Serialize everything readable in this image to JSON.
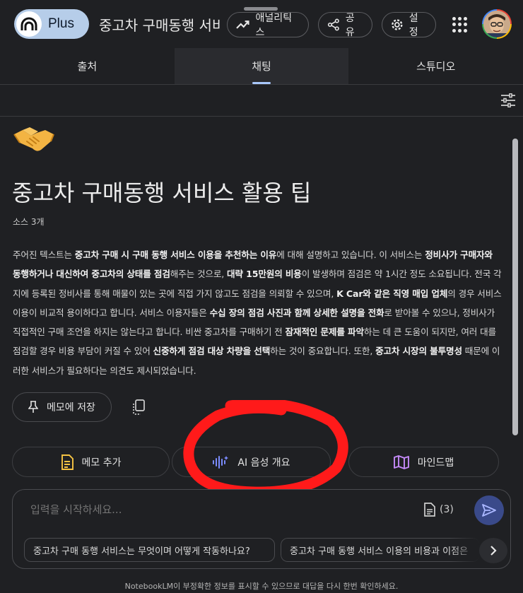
{
  "header": {
    "logo_label": "Plus",
    "notebook_title": "중고차 구매동행 서비",
    "analytics_label": "애널리틱스",
    "share_label": "공유",
    "settings_label": "설정"
  },
  "tabs": [
    {
      "label": "출처",
      "active": false
    },
    {
      "label": "채팅",
      "active": true
    },
    {
      "label": "스튜디오",
      "active": false
    }
  ],
  "note": {
    "emoji": "handshake-emoji",
    "title": "중고차 구매동행 서비스 활용 팁",
    "source_count": "소스 3개",
    "summary_segments": [
      {
        "t": "주어진 텍스트는 ",
        "b": false
      },
      {
        "t": "중고차 구매 시 구매 동행 서비스 이용을 추천하는 이유",
        "b": true
      },
      {
        "t": "에 대해 설명하고 있습니다. 이 서비스는 ",
        "b": false
      },
      {
        "t": "정비사가 구매자와 동행하거나 대신하여 중고차의 상태를 점검",
        "b": true
      },
      {
        "t": "해주는 것으로, ",
        "b": false
      },
      {
        "t": "대략 15만원의 비용",
        "b": true
      },
      {
        "t": "이 발생하며 점검은 약 1시간 정도 소요됩니다. 전국 각지에 등록된 정비사를 통해 매물이 있는 곳에 직접 가지 않고도 점검을 의뢰할 수 있으며, ",
        "b": false
      },
      {
        "t": "K Car와 같은 직영 매입 업체",
        "b": true
      },
      {
        "t": "의 경우 서비스 이용이 비교적 용이하다고 합니다. 서비스 이용자들은 ",
        "b": false
      },
      {
        "t": "수십 장의 점검 사진과 함께 상세한 설명을 전화",
        "b": true
      },
      {
        "t": "로 받아볼 수 있으나, 정비사가 직접적인 구매 조언을 하지는 않는다고 합니다. 비싼 중고차를 구매하기 전 ",
        "b": false
      },
      {
        "t": "잠재적인 문제를 파악",
        "b": true
      },
      {
        "t": "하는 데 큰 도움이 되지만, 여러 대를 점검할 경우 비용 부담이 커질 수 있어 ",
        "b": false
      },
      {
        "t": "신중하게 점검 대상 차량을 선택",
        "b": true
      },
      {
        "t": "하는 것이 중요합니다. 또한, ",
        "b": false
      },
      {
        "t": "중고차 시장의 불투명성",
        "b": true
      },
      {
        "t": " 때문에 이러한 서비스가 필요하다는 의견도 제시되었습니다.",
        "b": false
      }
    ],
    "save_to_memo_label": "메모에 저장"
  },
  "actions": {
    "add_memo_label": "메모 추가",
    "audio_overview_label": "AI 음성 개요",
    "mindmap_label": "마인드맵"
  },
  "chat": {
    "placeholder": "입력을 시작하세요...",
    "source_badge": "(3)",
    "suggestions": [
      "중고차 구매 동행 서비스는 무엇이며 어떻게 작동하나요?",
      "중고차 구매 동행 서비스 이용의 비용과 이점은"
    ]
  },
  "disclaimer": "NotebookLM이 부정확한 정보를 표시할 수 있으므로 대답을 다시 한번 확인하세요.",
  "colors": {
    "background": "#1f2023",
    "accent_tab": "#a8c7fa",
    "annotation_red": "#ff1a1a",
    "memo_icon": "#f6c343",
    "audio_icon": "#7b8cff",
    "mindmap_icon": "#c58af9"
  }
}
